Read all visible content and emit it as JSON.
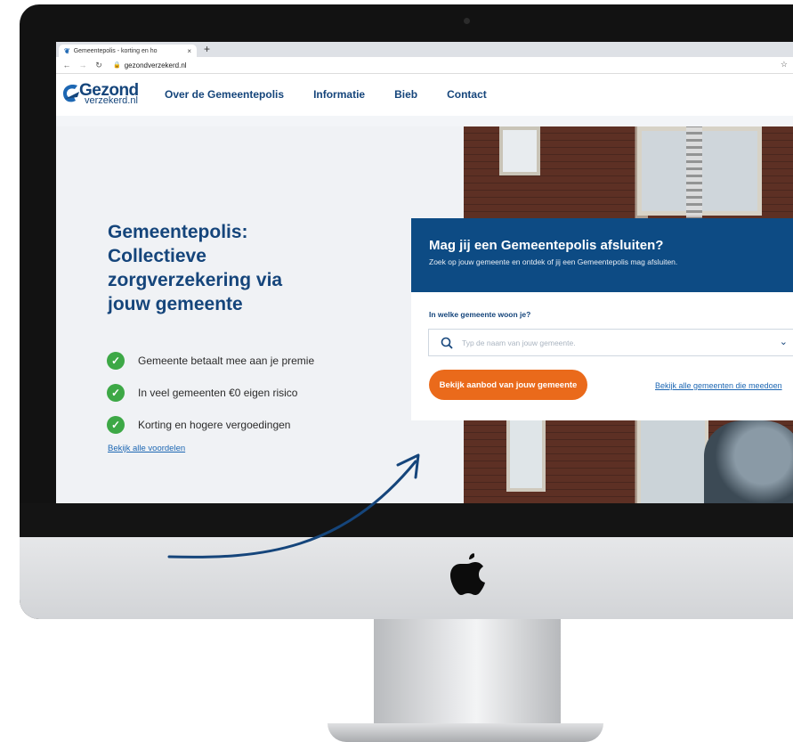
{
  "browser": {
    "tab_title": "Gemeentepolis - korting en ho",
    "tab_close": "×",
    "new_tab": "+",
    "url": "gezondverzekerd.nl"
  },
  "header": {
    "logo_word1": "Gezond",
    "logo_word2": "verzekerd.nl",
    "nav": [
      "Over de Gemeentepolis",
      "Informatie",
      "Bieb",
      "Contact"
    ]
  },
  "hero": {
    "title": "Gemeentepolis: Collectieve zorgverzekering via jouw gemeente",
    "benefits": [
      "Gemeente betaalt mee aan je premie",
      "In veel gemeenten €0 eigen risico",
      "Korting en hogere vergoedingen"
    ],
    "more_link": "Bekijk alle voordelen"
  },
  "card": {
    "title": "Mag jij een Gemeentepolis afsluiten?",
    "subtitle": "Zoek op jouw gemeente en ontdek of jij een Gemeentepolis mag afsluiten.",
    "label": "In welke gemeente woon je?",
    "search_placeholder": "Typ de naam van jouw gemeente.",
    "cta": "Bekijk aanbod van jouw gemeente",
    "all_link": "Bekijk alle gemeenten die meedoen"
  },
  "colors": {
    "brand_blue": "#15457b",
    "card_blue": "#0d4b84",
    "cta_orange": "#ea6a1b",
    "check_green": "#3da846"
  }
}
